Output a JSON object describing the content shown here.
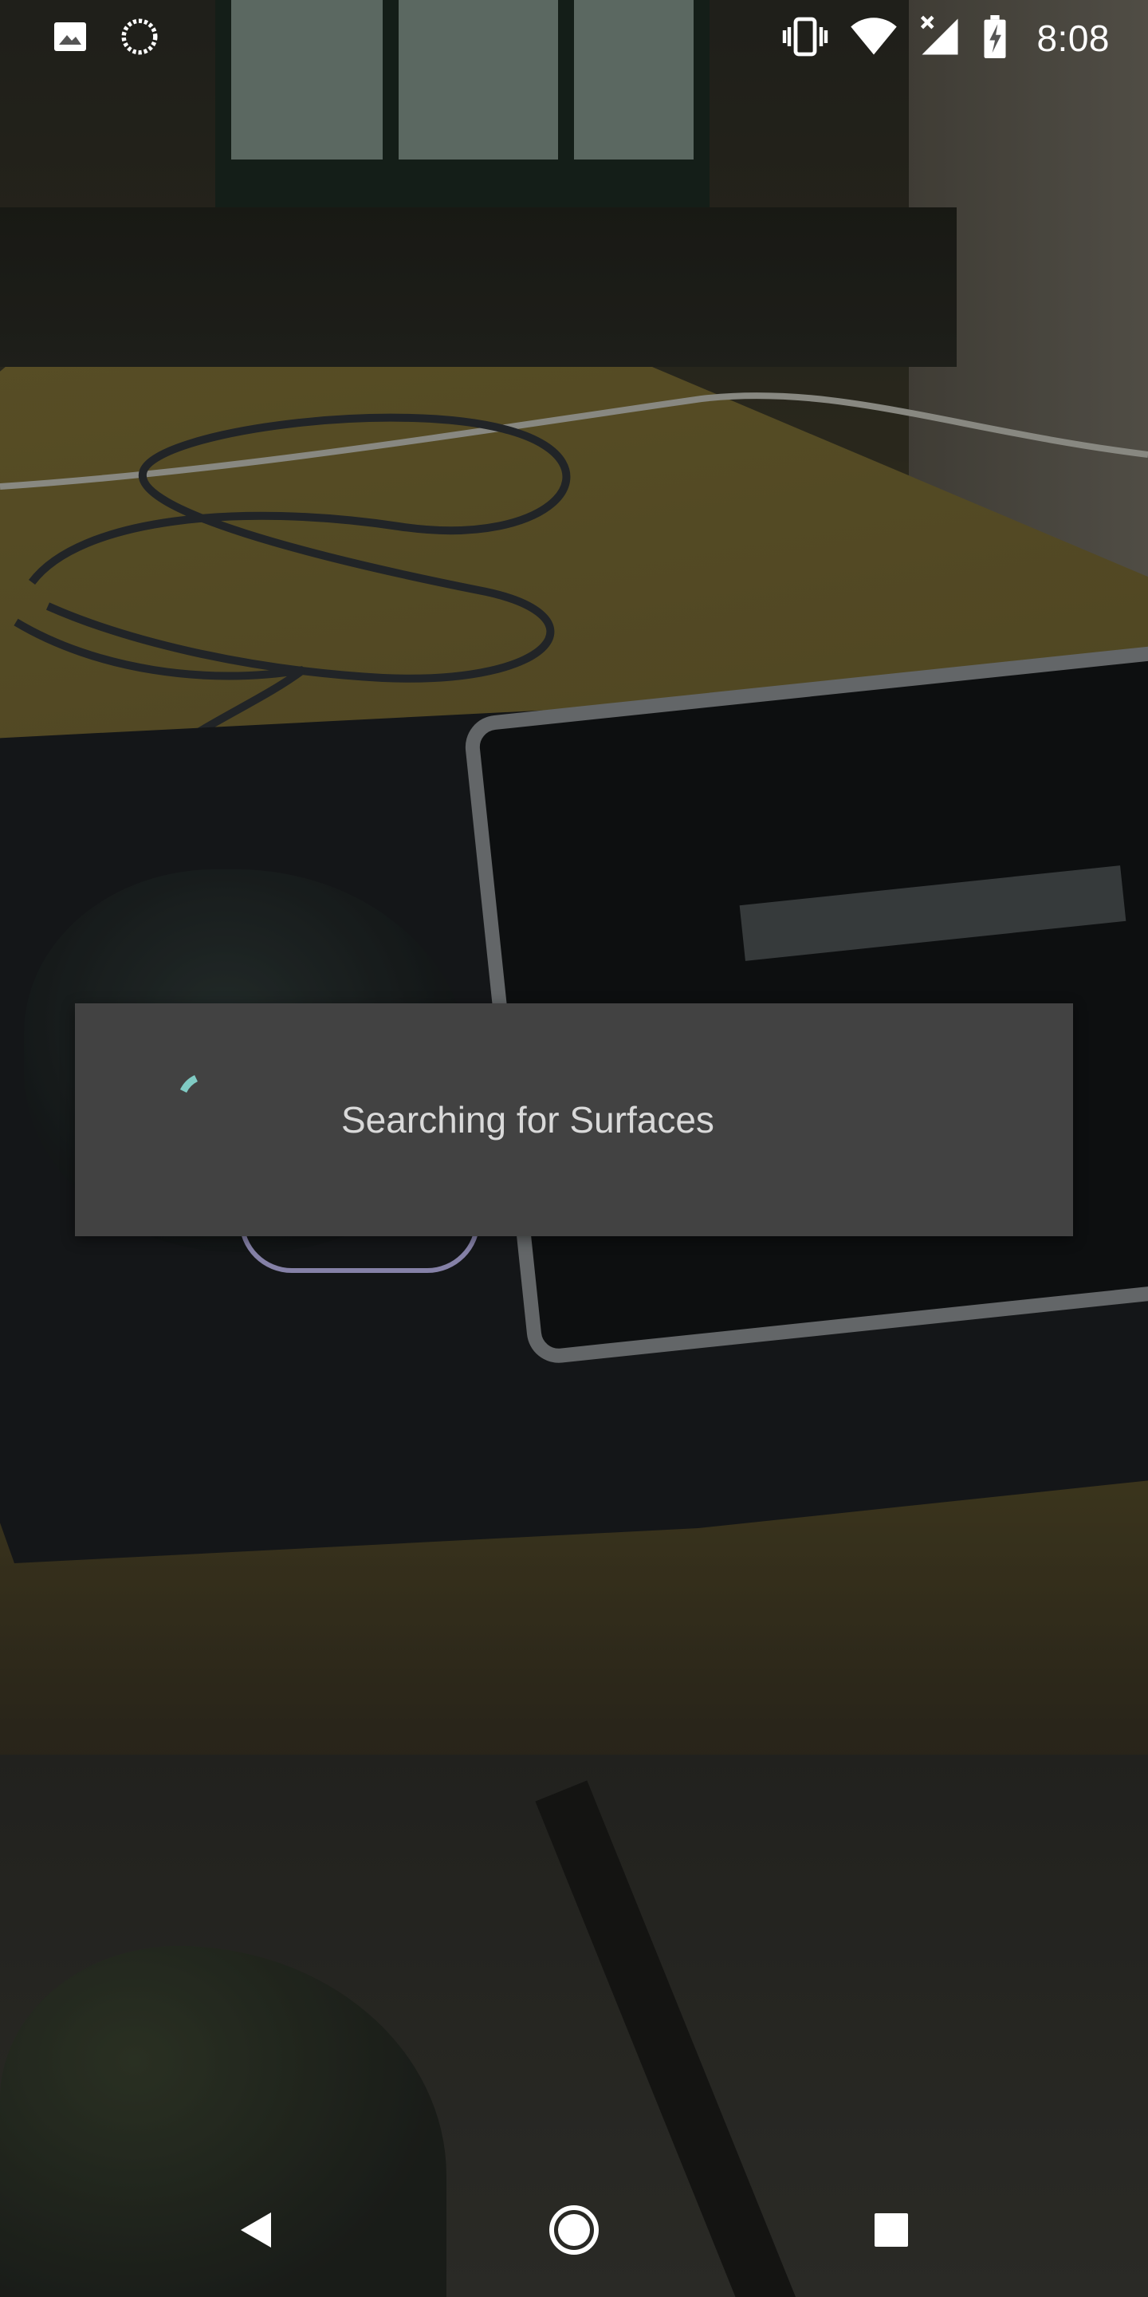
{
  "status_bar": {
    "time": "8:08",
    "left_icons": [
      "image-notification-icon",
      "sync-progress-icon"
    ],
    "right_icons": [
      "vibrate-icon",
      "wifi-icon",
      "cellular-no-data-icon",
      "battery-charging-icon"
    ]
  },
  "dialog": {
    "message": "Searching for Surfaces",
    "spinner_color": "#80cbc4",
    "background": "#424242"
  },
  "nav_bar": {
    "buttons": [
      "back-icon",
      "home-icon",
      "recents-icon"
    ]
  }
}
